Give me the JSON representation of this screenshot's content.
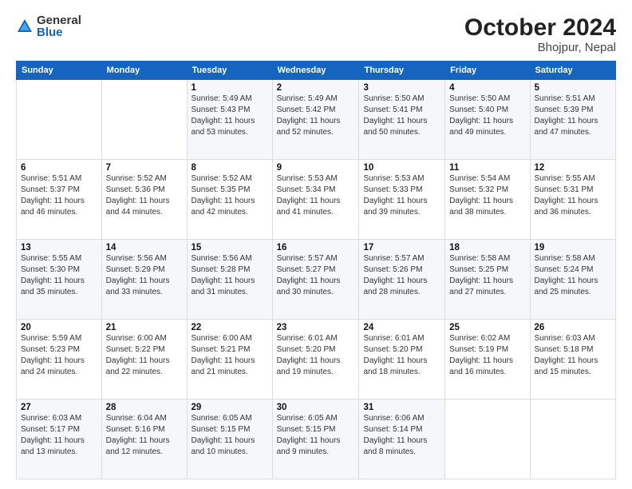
{
  "header": {
    "logo_general": "General",
    "logo_blue": "Blue",
    "month_title": "October 2024",
    "location": "Bhojpur, Nepal"
  },
  "days_of_week": [
    "Sunday",
    "Monday",
    "Tuesday",
    "Wednesday",
    "Thursday",
    "Friday",
    "Saturday"
  ],
  "weeks": [
    [
      {
        "day": "",
        "info": ""
      },
      {
        "day": "",
        "info": ""
      },
      {
        "day": "1",
        "info": "Sunrise: 5:49 AM\nSunset: 5:43 PM\nDaylight: 11 hours and 53 minutes."
      },
      {
        "day": "2",
        "info": "Sunrise: 5:49 AM\nSunset: 5:42 PM\nDaylight: 11 hours and 52 minutes."
      },
      {
        "day": "3",
        "info": "Sunrise: 5:50 AM\nSunset: 5:41 PM\nDaylight: 11 hours and 50 minutes."
      },
      {
        "day": "4",
        "info": "Sunrise: 5:50 AM\nSunset: 5:40 PM\nDaylight: 11 hours and 49 minutes."
      },
      {
        "day": "5",
        "info": "Sunrise: 5:51 AM\nSunset: 5:39 PM\nDaylight: 11 hours and 47 minutes."
      }
    ],
    [
      {
        "day": "6",
        "info": "Sunrise: 5:51 AM\nSunset: 5:37 PM\nDaylight: 11 hours and 46 minutes."
      },
      {
        "day": "7",
        "info": "Sunrise: 5:52 AM\nSunset: 5:36 PM\nDaylight: 11 hours and 44 minutes."
      },
      {
        "day": "8",
        "info": "Sunrise: 5:52 AM\nSunset: 5:35 PM\nDaylight: 11 hours and 42 minutes."
      },
      {
        "day": "9",
        "info": "Sunrise: 5:53 AM\nSunset: 5:34 PM\nDaylight: 11 hours and 41 minutes."
      },
      {
        "day": "10",
        "info": "Sunrise: 5:53 AM\nSunset: 5:33 PM\nDaylight: 11 hours and 39 minutes."
      },
      {
        "day": "11",
        "info": "Sunrise: 5:54 AM\nSunset: 5:32 PM\nDaylight: 11 hours and 38 minutes."
      },
      {
        "day": "12",
        "info": "Sunrise: 5:55 AM\nSunset: 5:31 PM\nDaylight: 11 hours and 36 minutes."
      }
    ],
    [
      {
        "day": "13",
        "info": "Sunrise: 5:55 AM\nSunset: 5:30 PM\nDaylight: 11 hours and 35 minutes."
      },
      {
        "day": "14",
        "info": "Sunrise: 5:56 AM\nSunset: 5:29 PM\nDaylight: 11 hours and 33 minutes."
      },
      {
        "day": "15",
        "info": "Sunrise: 5:56 AM\nSunset: 5:28 PM\nDaylight: 11 hours and 31 minutes."
      },
      {
        "day": "16",
        "info": "Sunrise: 5:57 AM\nSunset: 5:27 PM\nDaylight: 11 hours and 30 minutes."
      },
      {
        "day": "17",
        "info": "Sunrise: 5:57 AM\nSunset: 5:26 PM\nDaylight: 11 hours and 28 minutes."
      },
      {
        "day": "18",
        "info": "Sunrise: 5:58 AM\nSunset: 5:25 PM\nDaylight: 11 hours and 27 minutes."
      },
      {
        "day": "19",
        "info": "Sunrise: 5:58 AM\nSunset: 5:24 PM\nDaylight: 11 hours and 25 minutes."
      }
    ],
    [
      {
        "day": "20",
        "info": "Sunrise: 5:59 AM\nSunset: 5:23 PM\nDaylight: 11 hours and 24 minutes."
      },
      {
        "day": "21",
        "info": "Sunrise: 6:00 AM\nSunset: 5:22 PM\nDaylight: 11 hours and 22 minutes."
      },
      {
        "day": "22",
        "info": "Sunrise: 6:00 AM\nSunset: 5:21 PM\nDaylight: 11 hours and 21 minutes."
      },
      {
        "day": "23",
        "info": "Sunrise: 6:01 AM\nSunset: 5:20 PM\nDaylight: 11 hours and 19 minutes."
      },
      {
        "day": "24",
        "info": "Sunrise: 6:01 AM\nSunset: 5:20 PM\nDaylight: 11 hours and 18 minutes."
      },
      {
        "day": "25",
        "info": "Sunrise: 6:02 AM\nSunset: 5:19 PM\nDaylight: 11 hours and 16 minutes."
      },
      {
        "day": "26",
        "info": "Sunrise: 6:03 AM\nSunset: 5:18 PM\nDaylight: 11 hours and 15 minutes."
      }
    ],
    [
      {
        "day": "27",
        "info": "Sunrise: 6:03 AM\nSunset: 5:17 PM\nDaylight: 11 hours and 13 minutes."
      },
      {
        "day": "28",
        "info": "Sunrise: 6:04 AM\nSunset: 5:16 PM\nDaylight: 11 hours and 12 minutes."
      },
      {
        "day": "29",
        "info": "Sunrise: 6:05 AM\nSunset: 5:15 PM\nDaylight: 11 hours and 10 minutes."
      },
      {
        "day": "30",
        "info": "Sunrise: 6:05 AM\nSunset: 5:15 PM\nDaylight: 11 hours and 9 minutes."
      },
      {
        "day": "31",
        "info": "Sunrise: 6:06 AM\nSunset: 5:14 PM\nDaylight: 11 hours and 8 minutes."
      },
      {
        "day": "",
        "info": ""
      },
      {
        "day": "",
        "info": ""
      }
    ]
  ]
}
